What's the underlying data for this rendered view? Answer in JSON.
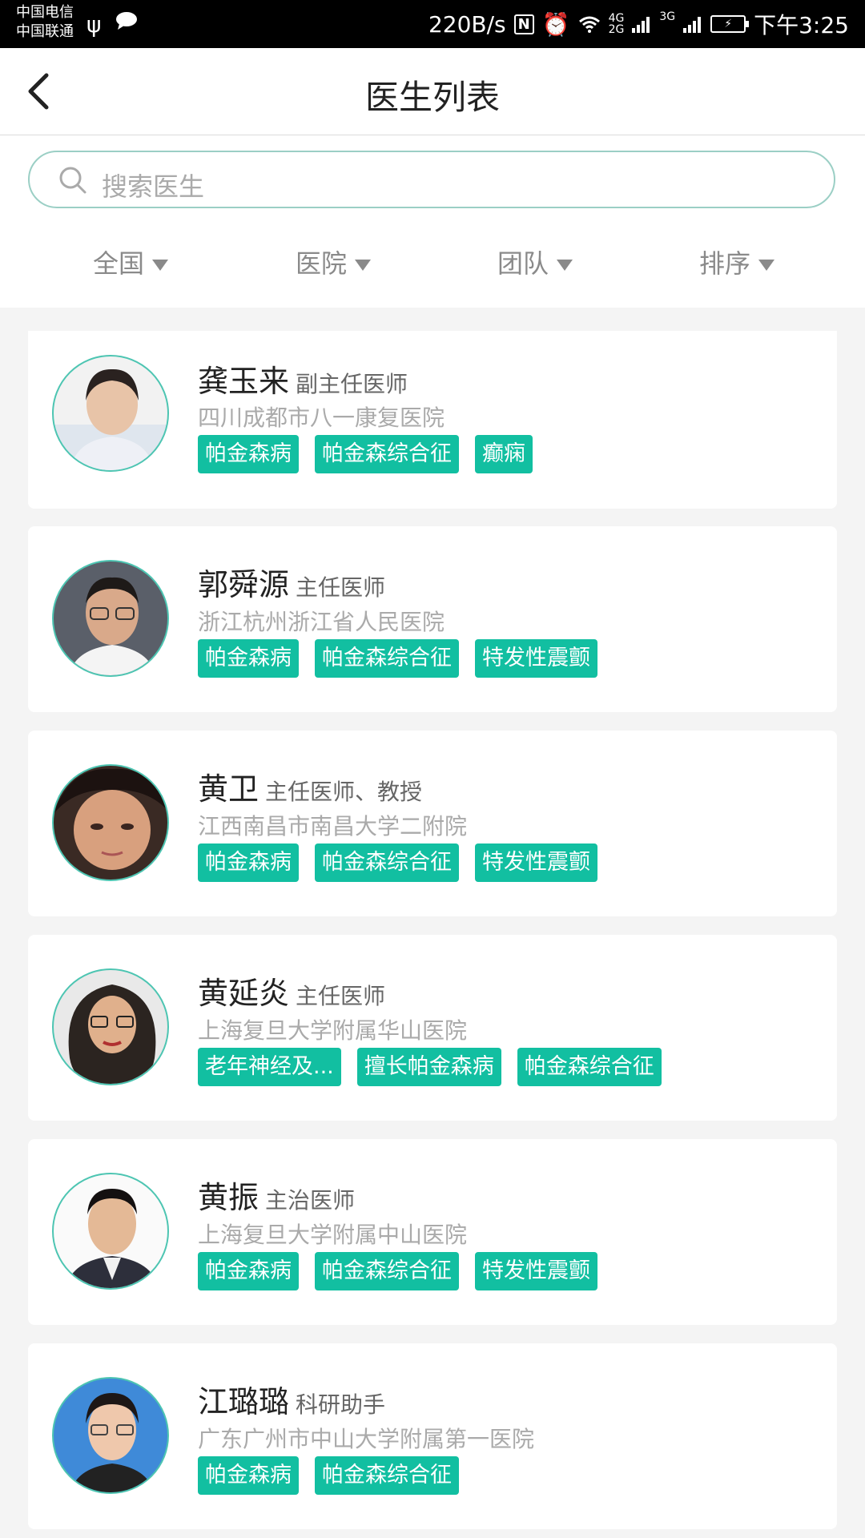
{
  "status_bar": {
    "carrier1": "中国电信",
    "carrier2": "中国联通",
    "speed": "220B/s",
    "net1": "4G",
    "net2": "2G",
    "net3": "3G",
    "time": "下午3:25"
  },
  "header": {
    "title": "医生列表"
  },
  "search": {
    "placeholder": "搜索医生"
  },
  "filters": [
    "全国",
    "医院",
    "团队",
    "排序"
  ],
  "doctors": [
    {
      "name": "龚玉来",
      "title": "副主任医师",
      "hospital": "四川成都市八一康复医院",
      "tags": [
        "帕金森病",
        "帕金森综合征",
        "癫痫"
      ]
    },
    {
      "name": "郭舜源",
      "title": "主任医师",
      "hospital": "浙江杭州浙江省人民医院",
      "tags": [
        "帕金森病",
        "帕金森综合征",
        "特发性震颤"
      ]
    },
    {
      "name": "黄卫",
      "title": "主任医师、教授",
      "hospital": "江西南昌市南昌大学二附院",
      "tags": [
        "帕金森病",
        "帕金森综合征",
        "特发性震颤"
      ]
    },
    {
      "name": "黄延炎",
      "title": "主任医师",
      "hospital": "上海复旦大学附属华山医院",
      "tags": [
        "老年神经及...",
        "擅长帕金森病",
        "帕金森综合征"
      ]
    },
    {
      "name": "黄振",
      "title": "主治医师",
      "hospital": "上海复旦大学附属中山医院",
      "tags": [
        "帕金森病",
        "帕金森综合征",
        "特发性震颤"
      ]
    },
    {
      "name": "江璐璐",
      "title": "科研助手",
      "hospital": "广东广州市中山大学附属第一医院",
      "tags": [
        "帕金森病",
        "帕金森综合征"
      ]
    }
  ]
}
